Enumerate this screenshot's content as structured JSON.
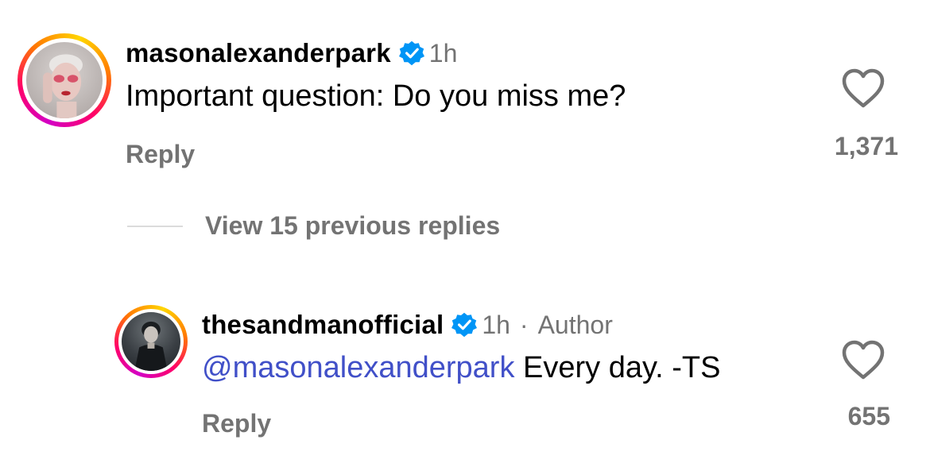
{
  "comments": [
    {
      "username": "masonalexanderpark",
      "time": "1h",
      "text": "Important question: Do you miss me?",
      "reply_label": "Reply",
      "likes": "1,371"
    },
    {
      "username": "thesandmanofficial",
      "time": "1h",
      "separator": "·",
      "author_label": "Author",
      "mention": "@masonalexanderpark",
      "text": " Every day. -TS",
      "reply_label": "Reply",
      "likes": "655"
    }
  ],
  "view_replies": "View 15 previous replies",
  "colors": {
    "verified": "#0095f6",
    "mention": "#4150c8",
    "secondary": "#737373"
  },
  "icons": [
    "verified-badge-icon",
    "heart-icon"
  ]
}
